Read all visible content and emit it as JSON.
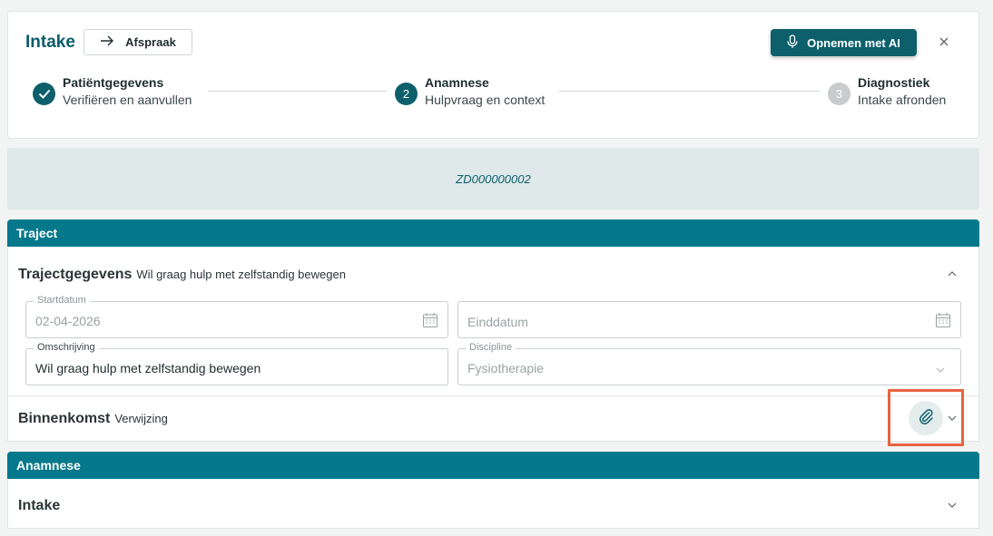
{
  "header": {
    "title": "Intake",
    "afspraak_label": "Afspraak",
    "record_label": "Opnemen met AI"
  },
  "steps": [
    {
      "number": "",
      "title": "Patiëntgegevens",
      "subtitle": "Verifiëren en aanvullen",
      "state": "done"
    },
    {
      "number": "2",
      "title": "Anamnese",
      "subtitle": "Hulpvraag en context",
      "state": "active"
    },
    {
      "number": "3",
      "title": "Diagnostiek",
      "subtitle": "Intake afronden",
      "state": "pending"
    }
  ],
  "banner": {
    "code": "ZD000000002"
  },
  "traject": {
    "section_title": "Traject",
    "group_title": "Trajectgegevens",
    "group_subtitle": "Wil graag hulp met zelfstandig bewegen",
    "startdatum_label": "Startdatum",
    "startdatum_value": "02-04-2026",
    "einddatum_placeholder": "Einddatum",
    "omschrijving_label": "Omschrijving",
    "omschrijving_value": "Wil graag hulp met zelfstandig bewegen",
    "discipline_label": "Discipline",
    "discipline_value": "Fysiotherapie",
    "binnenkomst_title": "Binnenkomst",
    "binnenkomst_subtitle": "Verwijzing"
  },
  "anamnese": {
    "section_title": "Anamnese",
    "group_title": "Intake"
  },
  "colors": {
    "brand": "#0d5f6b",
    "section_header": "#06788b",
    "highlight": "#e8633d"
  }
}
